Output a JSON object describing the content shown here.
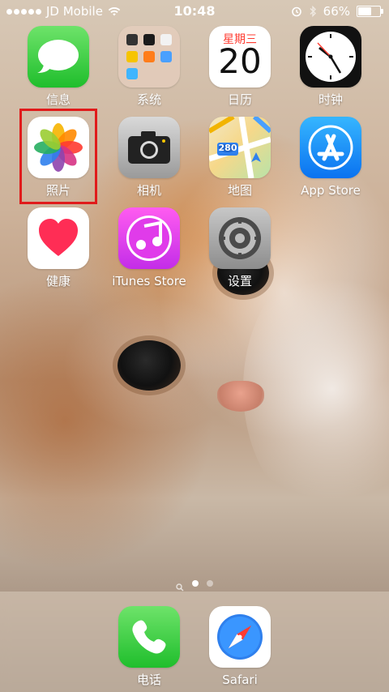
{
  "status_bar": {
    "carrier": "JD Mobile",
    "time": "10:48",
    "battery_percent": "66%",
    "battery_level": 0.66,
    "signal_dots": 5
  },
  "home": {
    "apps": [
      {
        "label": "信息",
        "icon": "messages-icon"
      },
      {
        "label": "系统",
        "icon": "folder-icon"
      },
      {
        "label": "日历",
        "icon": "calendar-icon",
        "weekday": "星期三",
        "day": "20"
      },
      {
        "label": "时钟",
        "icon": "clock-icon"
      },
      {
        "label": "照片",
        "icon": "photos-icon"
      },
      {
        "label": "相机",
        "icon": "camera-icon"
      },
      {
        "label": "地图",
        "icon": "maps-icon",
        "route_sign": "280"
      },
      {
        "label": "App Store",
        "icon": "app-store-icon"
      },
      {
        "label": "健康",
        "icon": "health-icon"
      },
      {
        "label": "iTunes Store",
        "icon": "itunes-store-icon"
      },
      {
        "label": "设置",
        "icon": "settings-icon"
      }
    ],
    "selected_app": "照片",
    "highlight_color": "#e01b1b"
  },
  "page_indicator": {
    "pages": 2,
    "current": 1
  },
  "dock": {
    "apps": [
      {
        "label": "电话",
        "icon": "phone-icon"
      },
      {
        "label": "Safari",
        "icon": "safari-icon"
      }
    ]
  }
}
